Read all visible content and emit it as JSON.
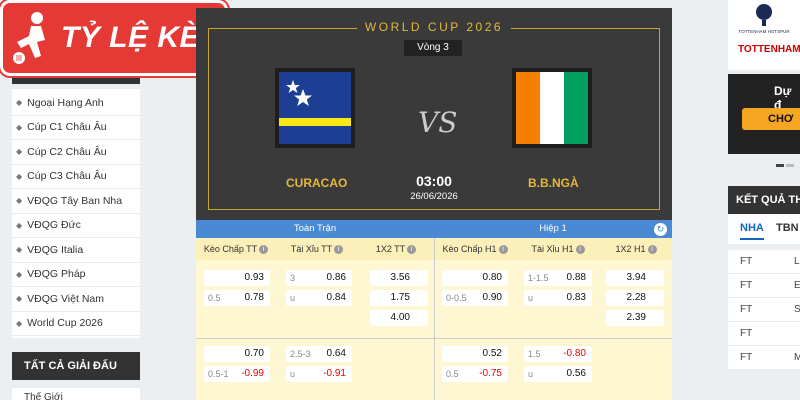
{
  "logo": {
    "text": "TỶ LỆ KÈO"
  },
  "sidebar": {
    "items": [
      "Ngoại Hạng Anh",
      "Cúp C1 Châu Âu",
      "Cúp C2 Châu Âu",
      "Cúp C3 Châu Âu",
      "VĐQG Tây Ban Nha",
      "VĐQG Đức",
      "VĐQG Italia",
      "VĐQG Pháp",
      "VĐQG Việt Nam",
      "World Cup 2026"
    ],
    "all_leagues_title": "TẤT CẢ GIẢI ĐẤU",
    "next_item": "Thế Giới"
  },
  "match": {
    "competition": "WORLD CUP 2026",
    "round": "Vòng 3",
    "home_team": "CURACAO",
    "away_team": "B.B.NGÀ",
    "vs": "VS",
    "time": "03:00",
    "date": "26/06/2026"
  },
  "odds": {
    "full_time_label": "Toàn Trận",
    "first_half_label": "Hiệp 1",
    "columns": [
      "Kèo Chấp TT",
      "Tài Xỉu TT",
      "1X2 TT",
      "Kèo Chấp H1",
      "Tài Xỉu H1",
      "1X2 H1"
    ],
    "group1": {
      "handicap_ft": [
        {
          "line": "",
          "odd": "0.93"
        },
        {
          "line": "0.5",
          "odd": "0.78"
        }
      ],
      "ou_ft": [
        {
          "line": "3",
          "odd": "0.86"
        },
        {
          "line": "u",
          "odd": "0.84"
        }
      ],
      "x12_ft": [
        "3.56",
        "1.75",
        "4.00"
      ],
      "handicap_h1": [
        {
          "line": "",
          "odd": "0.80"
        },
        {
          "line": "0-0.5",
          "odd": "0.90"
        }
      ],
      "ou_h1": [
        {
          "line": "1-1.5",
          "odd": "0.88"
        },
        {
          "line": "u",
          "odd": "0.83"
        }
      ],
      "x12_h1": [
        "3.94",
        "2.28",
        "2.39"
      ]
    },
    "group2": {
      "handicap_ft": [
        {
          "line": "",
          "odd": "0.70"
        },
        {
          "line": "0.5-1",
          "odd": "-0.99"
        }
      ],
      "ou_ft": [
        {
          "line": "2.5-3",
          "odd": "0.64"
        },
        {
          "line": "u",
          "odd": "-0.91"
        }
      ],
      "handicap_h1": [
        {
          "line": "",
          "odd": "0.52"
        },
        {
          "line": "0.5",
          "odd": "-0.75"
        }
      ],
      "ou_h1": [
        {
          "line": "1.5",
          "odd": "-0.80"
        },
        {
          "line": "u",
          "odd": "0.56"
        }
      ]
    }
  },
  "right": {
    "club_badge_text": "TOTTENHAM HOTSPUR",
    "club_name": "TOTTENHAM",
    "promo_text": "Dự đ",
    "promo_button": "CHƠ",
    "results_title": "KẾT QUẢ THI",
    "tabs": [
      "NHA",
      "TBN"
    ],
    "rows": [
      {
        "status": "FT",
        "team": "L"
      },
      {
        "status": "FT",
        "team": "E"
      },
      {
        "status": "FT",
        "team": "Su"
      },
      {
        "status": "FT",
        "team": ""
      },
      {
        "status": "FT",
        "team": "M"
      }
    ]
  },
  "colors": {
    "accent_gold": "#e5b73b",
    "header_blue": "#4a8ad4",
    "odds_bg": "#fff7d1",
    "logo_red": "#e53935"
  }
}
